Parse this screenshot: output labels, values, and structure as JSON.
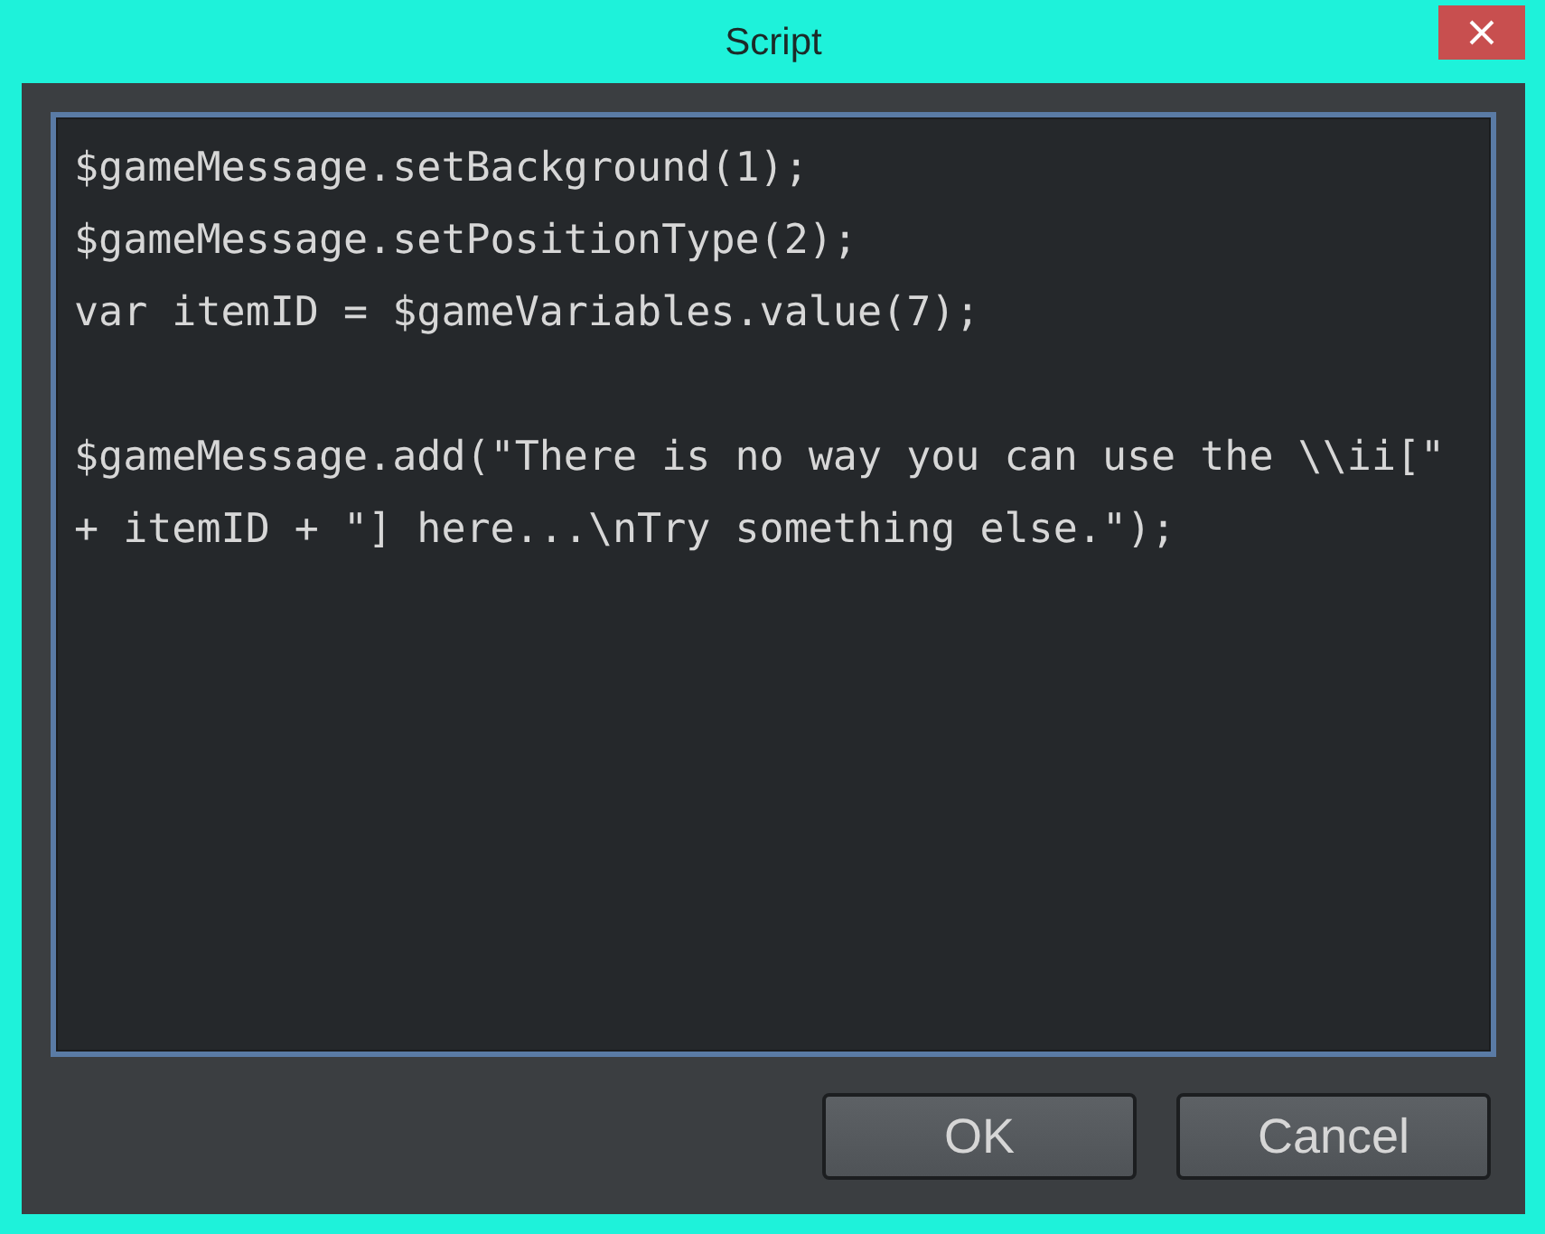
{
  "window": {
    "title": "Script"
  },
  "editor": {
    "value": "$gameMessage.setBackground(1);\n$gameMessage.setPositionType(2);\nvar itemID = $gameVariables.value(7);\n\n$gameMessage.add(\"There is no way you can use the \\\\ii[\" + itemID + \"] here...\\nTry something else.\");"
  },
  "buttons": [
    "OK",
    "Cancel"
  ]
}
